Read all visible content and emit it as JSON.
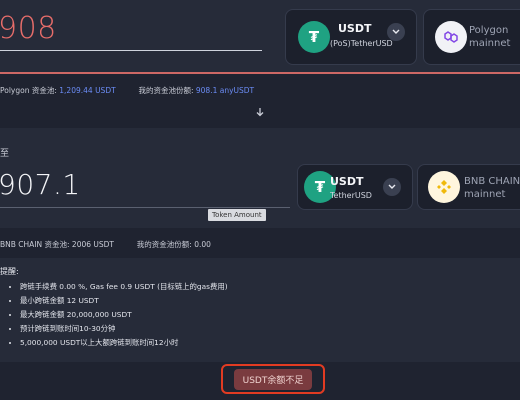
{
  "source": {
    "amount": "908",
    "token": {
      "symbol": "USDT",
      "name": "(PoS)TetherUSD"
    },
    "network": {
      "line1": "Polygon",
      "line2": "mainnet"
    },
    "pool": {
      "pool_label": "Polygon 资金池:",
      "pool_value": "1,209.44 USDT",
      "share_label": "我的资金池份额:",
      "share_value": "908.1 anyUSDT"
    }
  },
  "swap_arrow": "↓",
  "destination": {
    "corner_char": "至",
    "amount": "907.1",
    "amount_tag": "Token Amount",
    "token": {
      "symbol": "USDT",
      "name": "TetherUSD"
    },
    "network": {
      "line1": "BNB CHAIN",
      "line2": "mainnet"
    },
    "pool": {
      "pool_label": "BNB CHAIN 资金池:",
      "pool_value": "2006 USDT",
      "share_label": "我的资金池份额:",
      "share_value": "0.00"
    }
  },
  "notice": {
    "title": "提醒:",
    "items": [
      "跨链手续费 0.00 %, Gas fee 0.9 USDT (目标链上的gas费用)",
      "最小跨链金额 12 USDT",
      "最大跨链金额 20,000,000 USDT",
      "预计跨链到账时间10-30分钟",
      "5,000,000 USDT以上大额跨链到账时间12小时"
    ]
  },
  "submit_label": "USDT余额不足",
  "colors": {
    "background": "#1f2330",
    "panel": "#262b39",
    "source_amount": "#e76d6a",
    "pool_value_blue": "#6b8cf5",
    "button_border": "#e23b22",
    "tether_green": "#1fa282"
  }
}
